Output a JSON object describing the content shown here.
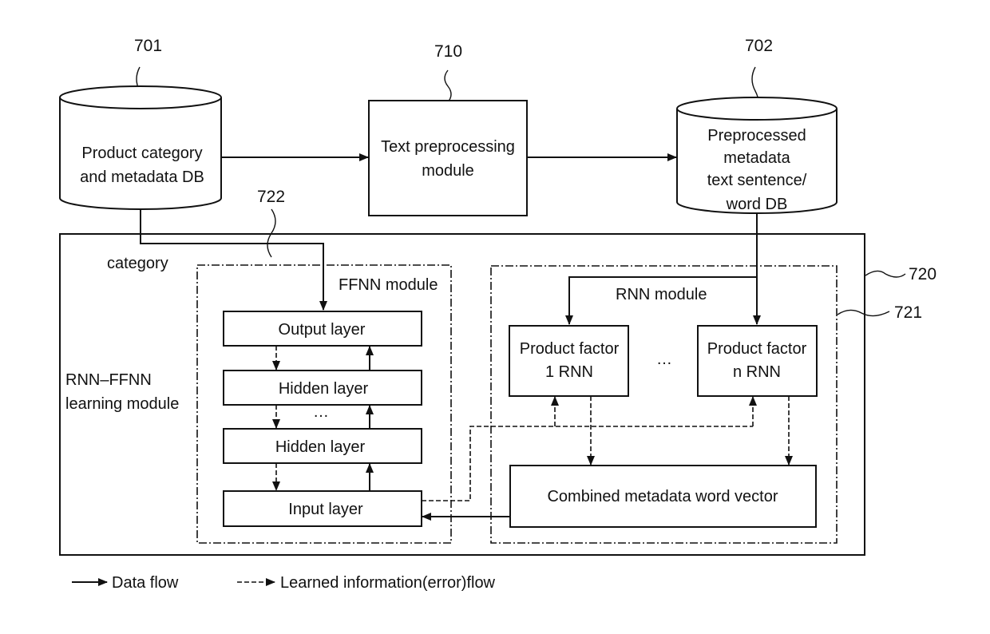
{
  "figure": {
    "refs": {
      "db_source": "701",
      "preproc": "710",
      "db_preproc": "702",
      "learning": "720",
      "rnn": "721",
      "ffnn": "722"
    },
    "db_source": {
      "lines": [
        "Product category",
        "and metadata DB"
      ]
    },
    "preproc_module": {
      "lines": [
        "Text preprocessing",
        "module"
      ]
    },
    "db_preproc": {
      "lines": [
        "Preprocessed",
        "metadata",
        "text sentence/",
        "word DB"
      ]
    },
    "learning_module": {
      "lines": [
        "RNN–FFNN",
        "learning module"
      ]
    },
    "category_label": "category",
    "ffnn": {
      "title": "FFNN module",
      "layers": [
        "Output layer",
        "Hidden layer",
        "Hidden layer",
        "Input layer"
      ],
      "ellipsis": "…"
    },
    "rnn": {
      "title": "RNN module",
      "factor1": [
        "Product factor",
        "1 RNN"
      ],
      "factorn": [
        "Product factor",
        "n RNN"
      ],
      "ellipsis": "…",
      "combined": "Combined metadata word vector"
    },
    "legend": {
      "data_flow": "Data flow",
      "learned_flow": "Learned information(error)flow"
    }
  }
}
